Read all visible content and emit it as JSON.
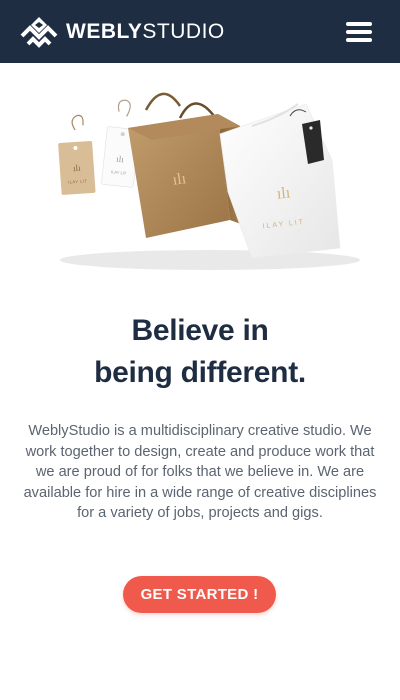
{
  "header": {
    "logo_bold": "WEBLY",
    "logo_light": "STUDIO",
    "menu_icon": "hamburger-menu-icon"
  },
  "hero": {
    "product_brand": "ILAY LIT"
  },
  "main": {
    "headline_line1": "Believe in",
    "headline_line2": "being different.",
    "body": "WeblyStudio is a multidisciplinary creative studio. We work together to design, create and produce work that we are proud of for folks that we believe in. We are available for hire in a wide range of creative disciplines for a variety of jobs, projects and gigs.",
    "cta_label": "GET STARTED !"
  },
  "colors": {
    "header_bg": "#1f2d42",
    "headline": "#1f2d42",
    "body_text": "#5b6470",
    "cta_bg": "#f05a4c"
  }
}
